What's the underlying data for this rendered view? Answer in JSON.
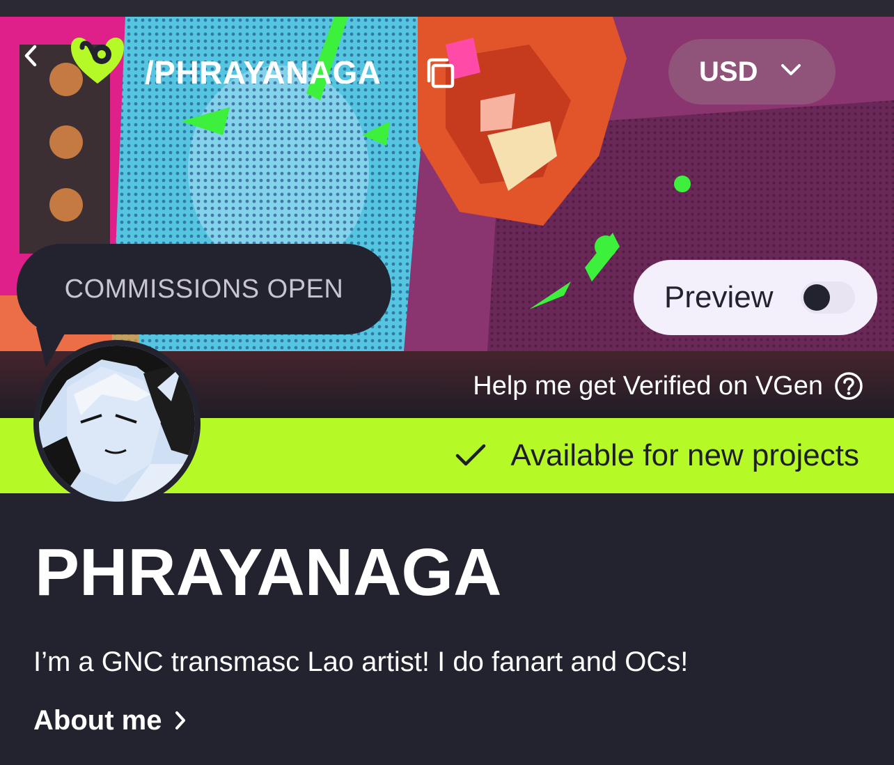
{
  "header": {
    "handle": "/PHRAYANAGA",
    "currency": "USD",
    "back_icon": "chevron-left-icon",
    "copy_icon": "copy-icon",
    "logo": "vgen-logo"
  },
  "banner": {
    "commissions_status": "COMMISSIONS OPEN",
    "preview_label": "Preview",
    "preview_toggle_on": false,
    "verify_text": "Help me get Verified on VGen",
    "verify_icon": "help-circle-icon"
  },
  "availability": {
    "icon": "checkmark-icon",
    "label": "Available for new projects"
  },
  "profile": {
    "name": "PHRAYANAGA",
    "bio": "I’m a GNC transmasc Lao artist! I do fanart and OCs!",
    "about_label": "About me",
    "about_icon": "chevron-right-icon"
  },
  "colors": {
    "background": "#23222f",
    "accent_lime": "#b5fa27",
    "text_primary": "#ffffff",
    "pill_light": "#f4f0fb"
  }
}
